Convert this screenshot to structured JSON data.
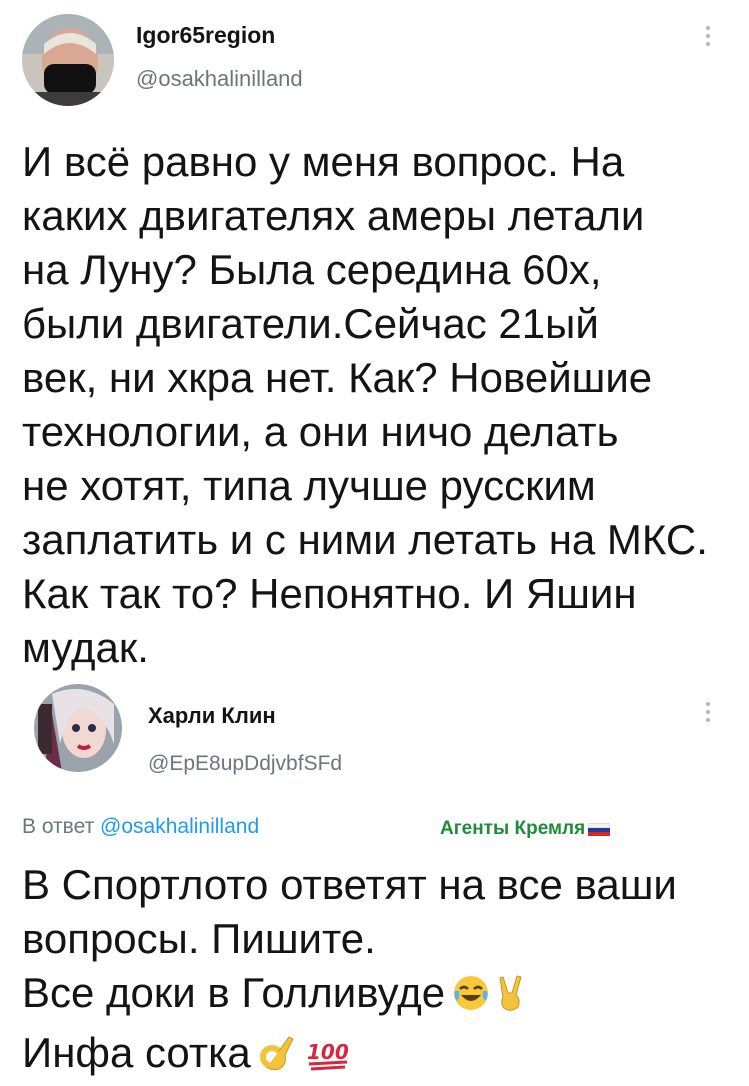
{
  "tweet": {
    "author_name": "Igor65region",
    "author_handle": "@osakhalinilland",
    "text_lines": [
      "И всё равно у меня вопрос. На",
      "каких двигателях амеры летали",
      "на Луну? Была середина 60х,",
      "были двигатели.Сейчас 21ый",
      "век, ни хкра нет. Как? Новейшие",
      "технологии, а они ничо делать",
      "не хотят, типа лучше русским",
      "заплатить и с ними летать на МКС.",
      "Как так то? Непонятно. И Яшин",
      "мудак."
    ]
  },
  "reply": {
    "author_name": "Харли Клин",
    "author_handle": "@EpE8upDdjvbfSFd",
    "reply_prefix": "В ответ",
    "reply_to": "@osakhalinilland",
    "tag_label": "Агенты Кремля",
    "text_lines": [
      "В Спортлото ответят на все ваши",
      "вопросы. Пишите.",
      "Все доки в Голливуде",
      "Инфа сотка"
    ],
    "emojis": [
      "tears-of-joy-emoji",
      "victory-hand-emoji",
      "ok-hand-emoji",
      "hundred-points-emoji"
    ]
  },
  "icons": {
    "more": "more-vertical-icon",
    "flag": "russian-flag-icon"
  },
  "colors": {
    "link": "#1d9bf0",
    "secondary_text": "#6b7680",
    "tag_green": "#1e8c3a"
  }
}
